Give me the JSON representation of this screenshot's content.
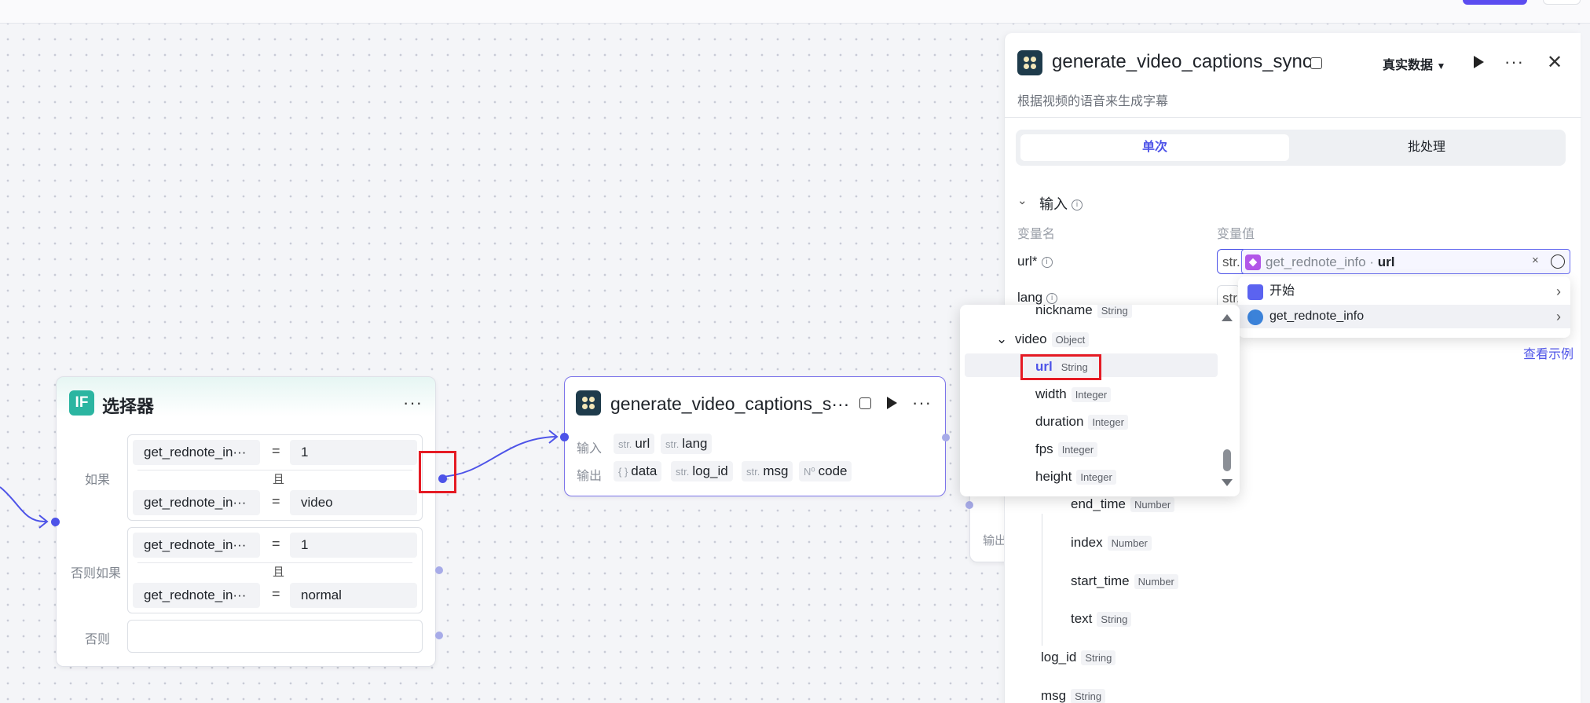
{
  "selector_node": {
    "title": "选择器",
    "icon_text": "IF",
    "more": "···",
    "labels": {
      "if": "如果",
      "else_if": "否则如果",
      "else": "否则"
    },
    "if_conditions": [
      {
        "left": "get_rednote_in···",
        "op": "=",
        "right": "1"
      },
      {
        "left": "get_rednote_in···",
        "op": "=",
        "right": "video"
      }
    ],
    "else_if_conditions": [
      {
        "left": "get_rednote_in···",
        "op": "=",
        "right": "1"
      },
      {
        "left": "get_rednote_in···",
        "op": "=",
        "right": "normal"
      }
    ],
    "and_label": "且"
  },
  "captions_node": {
    "title": "generate_video_captions_s···",
    "more": "···",
    "input_label": "输入",
    "output_label": "输出",
    "inputs": [
      {
        "type": "str.",
        "name": "url"
      },
      {
        "type": "str.",
        "name": "lang"
      }
    ],
    "outputs": [
      {
        "type": "{ }",
        "name": "data"
      },
      {
        "type": "str.",
        "name": "log_id"
      },
      {
        "type": "str.",
        "name": "msg"
      },
      {
        "type": "N⁰",
        "name": "code"
      }
    ]
  },
  "panel": {
    "title": "generate_video_captions_sync",
    "data_mode": "真实数据",
    "description": "根据视频的语音来生成字幕",
    "tabs": {
      "single": "单次",
      "batch": "批处理"
    },
    "input_section": "输入",
    "col_name": "变量名",
    "col_value": "变量值",
    "vars": [
      {
        "name": "url*"
      },
      {
        "name": "lang"
      }
    ],
    "url_type": "str.",
    "lang_type": "str.",
    "url_ref": {
      "node": "get_rednote_info",
      "sep": " · ",
      "field": "url"
    },
    "view_example": "查看示例",
    "output_label": "输出",
    "tree": [
      {
        "name": "end_time",
        "type": "Number"
      },
      {
        "name": "index",
        "type": "Number"
      },
      {
        "name": "start_time",
        "type": "Number"
      },
      {
        "name": "text",
        "type": "String"
      }
    ],
    "tree_bottom": [
      {
        "name": "log_id",
        "type": "String"
      },
      {
        "name": "msg",
        "type": "String"
      }
    ]
  },
  "node_picker": {
    "items": [
      {
        "label": "开始"
      },
      {
        "label": "get_rednote_info"
      }
    ]
  },
  "field_dropdown": {
    "rows": [
      {
        "name": "nickname",
        "type": "String"
      },
      {
        "name": "video",
        "type": "Object"
      },
      {
        "name": "url",
        "type": "String"
      },
      {
        "name": "width",
        "type": "Integer"
      },
      {
        "name": "duration",
        "type": "Integer"
      },
      {
        "name": "fps",
        "type": "Integer"
      },
      {
        "name": "height",
        "type": "Integer"
      }
    ]
  },
  "colors": {
    "accent": "#4d53e8",
    "highlight_border": "#e51b24",
    "if_icon": "#2bb5a1"
  }
}
